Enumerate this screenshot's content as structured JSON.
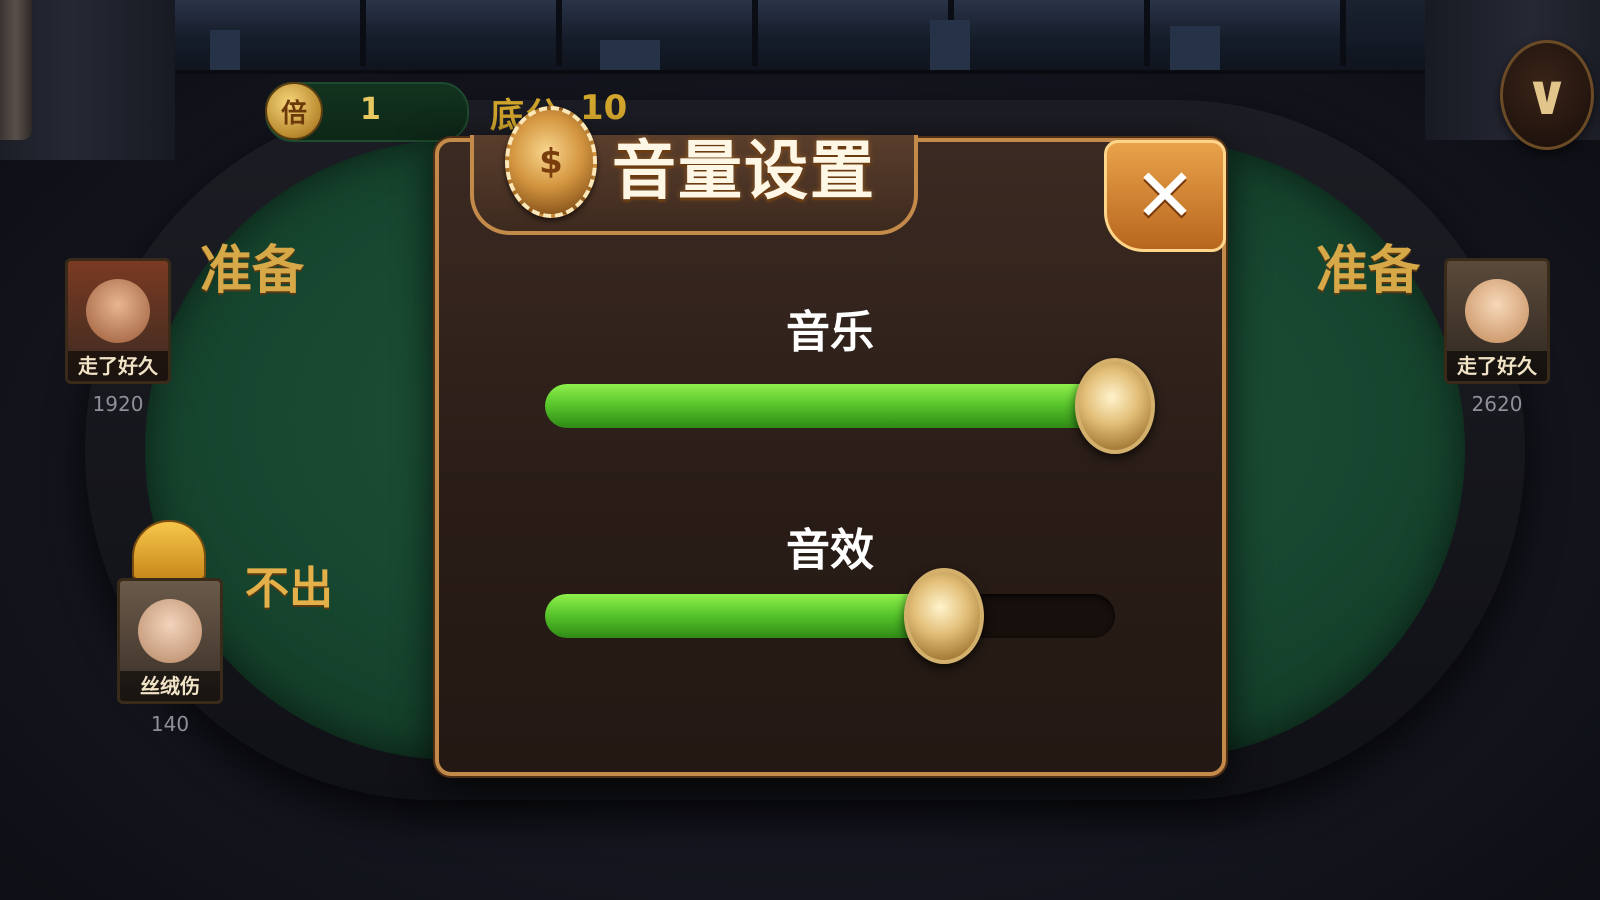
{
  "top_bar": {
    "multiplier_icon_char": "倍",
    "multiplier_value": "1",
    "base_score_label": "底分",
    "base_score_value": "10"
  },
  "menu": {
    "icon": "chevron-down-icon"
  },
  "players": [
    {
      "position": "left-top",
      "name": "走了好久",
      "score": "1920",
      "status": "准备"
    },
    {
      "position": "right-top",
      "name": "走了好久",
      "score": "2620",
      "status": "准备"
    },
    {
      "position": "left-bottom",
      "name": "丝绒伤",
      "score": "140",
      "status": "不出"
    }
  ],
  "dialog": {
    "title": "音量设置",
    "chip_symbol": "$",
    "close_label": "✕",
    "sliders": [
      {
        "label": "音乐",
        "level": 1.0
      },
      {
        "label": "音效",
        "level": 0.7
      }
    ]
  },
  "colors": {
    "slider_green": "#55c22a",
    "dialog_border": "#c48a4a",
    "status_gold": "#d6a848"
  }
}
